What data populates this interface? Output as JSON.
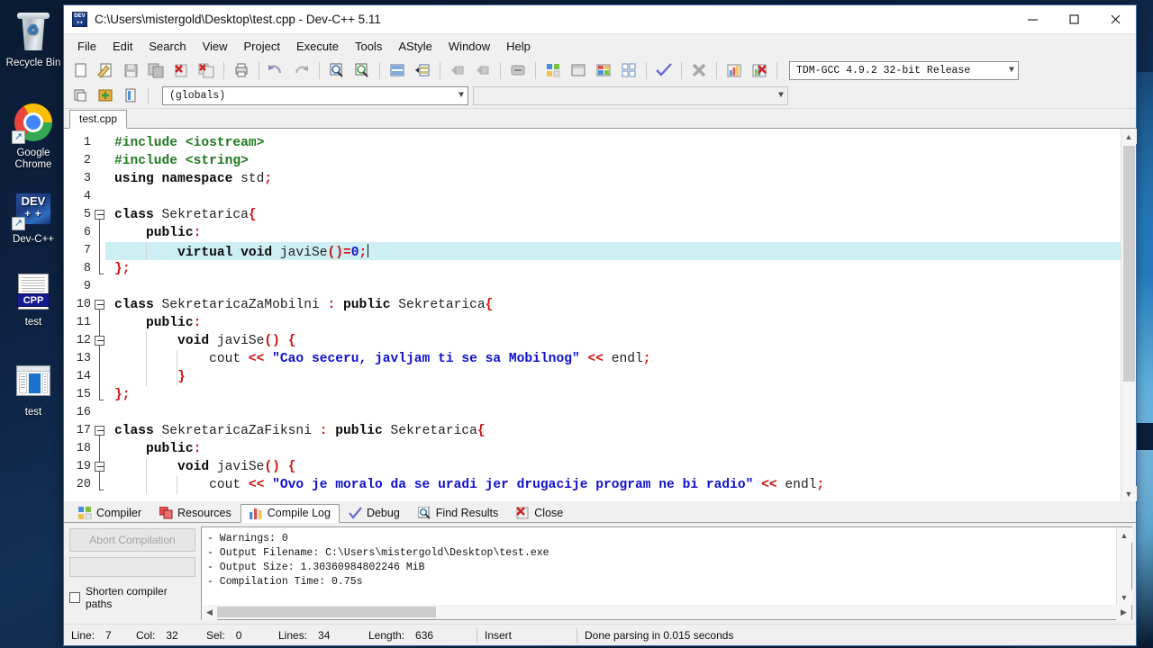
{
  "desktop": {
    "icons": [
      {
        "label": "Recycle Bin",
        "icon": "recycle-bin-icon"
      },
      {
        "label": "Google Chrome",
        "icon": "chrome-icon"
      },
      {
        "label": "Dev-C++",
        "icon": "devcpp-icon"
      },
      {
        "label": "test",
        "icon": "cpp-file-icon"
      },
      {
        "label": "test",
        "icon": "exe-file-icon"
      }
    ]
  },
  "window": {
    "title": "C:\\Users\\mistergold\\Desktop\\test.cpp - Dev-C++ 5.11",
    "app_icon": "devcpp-icon",
    "controls": {
      "minimize": "minimize-icon",
      "maximize": "maximize-icon",
      "close": "close-icon"
    }
  },
  "menu": {
    "items": [
      "File",
      "Edit",
      "Search",
      "View",
      "Project",
      "Execute",
      "Tools",
      "AStyle",
      "Window",
      "Help"
    ]
  },
  "toolbar": {
    "compiler_set": "TDM-GCC 4.9.2 32-bit Release",
    "groups": [
      [
        "new-file-icon",
        "open-file-icon",
        "save-icon",
        "save-all-icon",
        "close-file-icon",
        "close-all-icon"
      ],
      [
        "print-icon"
      ],
      [
        "undo-icon",
        "redo-icon"
      ],
      [
        "find-icon",
        "replace-icon",
        "goto-line-icon",
        "goto-function-icon"
      ],
      [
        "back-icon",
        "forward-icon"
      ],
      [
        "compile-icon"
      ],
      [
        "run-icon",
        "compile-run-icon",
        "rebuild-all-icon",
        "syntax-check-icon"
      ],
      [
        "debug-icon"
      ],
      [
        "profile-icon",
        "delete-profile-icon"
      ]
    ],
    "row2": [
      "new-class-icon",
      "insert-snippet-icon",
      "toggle-panel-icon"
    ],
    "globals_selector": "(globals)",
    "class_selector": ""
  },
  "tabs": {
    "files": [
      {
        "label": "test.cpp",
        "active": true
      }
    ]
  },
  "editor": {
    "lines": [
      {
        "n": "1",
        "fold": "none",
        "highlighted": false,
        "tokens": [
          {
            "t": "#include <iostream>",
            "c": "pre"
          }
        ]
      },
      {
        "n": "2",
        "fold": "none",
        "highlighted": false,
        "tokens": [
          {
            "t": "#include <string>",
            "c": "pre"
          }
        ]
      },
      {
        "n": "3",
        "fold": "none",
        "highlighted": false,
        "tokens": [
          {
            "t": "using namespace",
            "c": "kw"
          },
          {
            "t": " std",
            "c": "plain"
          },
          {
            "t": ";",
            "c": "pun"
          }
        ]
      },
      {
        "n": "4",
        "fold": "none",
        "highlighted": false,
        "tokens": []
      },
      {
        "n": "5",
        "fold": "start",
        "highlighted": false,
        "tokens": [
          {
            "t": "class",
            "c": "kw"
          },
          {
            "t": " Sekretarica",
            "c": "plain"
          },
          {
            "t": "{",
            "c": "pun"
          }
        ]
      },
      {
        "n": "6",
        "fold": "bar",
        "highlighted": false,
        "tokens": [
          {
            "t": "    public",
            "c": "kw"
          },
          {
            "t": ":",
            "c": "pun"
          }
        ]
      },
      {
        "n": "7",
        "fold": "bar",
        "highlighted": true,
        "tokens": [
          {
            "t": "        virtual void",
            "c": "kw"
          },
          {
            "t": " javiSe",
            "c": "plain"
          },
          {
            "t": "()=",
            "c": "pun"
          },
          {
            "t": "0",
            "c": "num"
          },
          {
            "t": ";",
            "c": "pun"
          }
        ],
        "caret": true
      },
      {
        "n": "8",
        "fold": "end",
        "highlighted": false,
        "tokens": [
          {
            "t": "};",
            "c": "pun"
          }
        ]
      },
      {
        "n": "9",
        "fold": "none",
        "highlighted": false,
        "tokens": []
      },
      {
        "n": "10",
        "fold": "start",
        "highlighted": false,
        "tokens": [
          {
            "t": "class",
            "c": "kw"
          },
          {
            "t": " SekretaricaZaMobilni ",
            "c": "plain"
          },
          {
            "t": ":",
            "c": "pun"
          },
          {
            "t": " public",
            "c": "kw"
          },
          {
            "t": " Sekretarica",
            "c": "plain"
          },
          {
            "t": "{",
            "c": "pun"
          }
        ]
      },
      {
        "n": "11",
        "fold": "bar",
        "highlighted": false,
        "tokens": [
          {
            "t": "    public",
            "c": "kw"
          },
          {
            "t": ":",
            "c": "pun"
          }
        ]
      },
      {
        "n": "12",
        "fold": "start2",
        "highlighted": false,
        "tokens": [
          {
            "t": "        void",
            "c": "kw"
          },
          {
            "t": " javiSe",
            "c": "plain"
          },
          {
            "t": "()",
            "c": "pun"
          },
          {
            "t": " ",
            "c": "plain"
          },
          {
            "t": "{",
            "c": "pun"
          }
        ]
      },
      {
        "n": "13",
        "fold": "bar2",
        "highlighted": false,
        "tokens": [
          {
            "t": "            cout ",
            "c": "plain"
          },
          {
            "t": "<<",
            "c": "pun"
          },
          {
            "t": " \"Cao seceru, javljam ti se sa Mobilnog\"",
            "c": "str"
          },
          {
            "t": " <<",
            "c": "pun"
          },
          {
            "t": " endl",
            "c": "plain"
          },
          {
            "t": ";",
            "c": "pun"
          }
        ]
      },
      {
        "n": "14",
        "fold": "end2",
        "highlighted": false,
        "tokens": [
          {
            "t": "        ",
            "c": "plain"
          },
          {
            "t": "}",
            "c": "pun"
          }
        ]
      },
      {
        "n": "15",
        "fold": "end",
        "highlighted": false,
        "tokens": [
          {
            "t": "};",
            "c": "pun"
          }
        ]
      },
      {
        "n": "16",
        "fold": "none",
        "highlighted": false,
        "tokens": []
      },
      {
        "n": "17",
        "fold": "start",
        "highlighted": false,
        "tokens": [
          {
            "t": "class",
            "c": "kw"
          },
          {
            "t": " SekretaricaZaFiksni ",
            "c": "plain"
          },
          {
            "t": ":",
            "c": "pun"
          },
          {
            "t": " public",
            "c": "kw"
          },
          {
            "t": " Sekretarica",
            "c": "plain"
          },
          {
            "t": "{",
            "c": "pun"
          }
        ]
      },
      {
        "n": "18",
        "fold": "bar",
        "highlighted": false,
        "tokens": [
          {
            "t": "    public",
            "c": "kw"
          },
          {
            "t": ":",
            "c": "pun"
          }
        ]
      },
      {
        "n": "19",
        "fold": "start2",
        "highlighted": false,
        "tokens": [
          {
            "t": "        void",
            "c": "kw"
          },
          {
            "t": " javiSe",
            "c": "plain"
          },
          {
            "t": "()",
            "c": "pun"
          },
          {
            "t": " ",
            "c": "plain"
          },
          {
            "t": "{",
            "c": "pun"
          }
        ]
      },
      {
        "n": "20",
        "fold": "bar2",
        "highlighted": false,
        "tokens": [
          {
            "t": "            cout ",
            "c": "plain"
          },
          {
            "t": "<<",
            "c": "pun"
          },
          {
            "t": " \"Ovo je moralo da se uradi jer drugacije program ne bi radio\"",
            "c": "str"
          },
          {
            "t": " <<",
            "c": "pun"
          },
          {
            "t": " endl",
            "c": "plain"
          },
          {
            "t": ";",
            "c": "pun"
          }
        ]
      }
    ]
  },
  "bottom_panel": {
    "tabs": [
      {
        "label": "Compiler",
        "icon": "compiler-icon",
        "active": false
      },
      {
        "label": "Resources",
        "icon": "resources-icon",
        "active": false
      },
      {
        "label": "Compile Log",
        "icon": "compile-log-icon",
        "active": true
      },
      {
        "label": "Debug",
        "icon": "debug-check-icon",
        "active": false
      },
      {
        "label": "Find Results",
        "icon": "find-results-icon",
        "active": false
      },
      {
        "label": "Close",
        "icon": "close-panel-icon",
        "active": false
      }
    ],
    "abort_label": "Abort Compilation",
    "shorten_label": "Shorten compiler paths",
    "shorten_checked": false,
    "log_lines": [
      "- Warnings: 0",
      "- Output Filename: C:\\Users\\mistergold\\Desktop\\test.exe",
      "- Output Size: 1.30360984802246 MiB",
      "- Compilation Time: 0.75s"
    ]
  },
  "statusbar": {
    "line_key": "Line:",
    "line_val": "7",
    "col_key": "Col:",
    "col_val": "32",
    "sel_key": "Sel:",
    "sel_val": "0",
    "lines_key": "Lines:",
    "lines_val": "34",
    "length_key": "Length:",
    "length_val": "636",
    "mode": "Insert",
    "message": "Done parsing in 0.015 seconds"
  },
  "colors": {
    "accent": "#1874cd",
    "highlight_line": "#cdeef3",
    "string": "#1010cf",
    "punct": "#d01010",
    "preproc": "#1f7a1f"
  }
}
